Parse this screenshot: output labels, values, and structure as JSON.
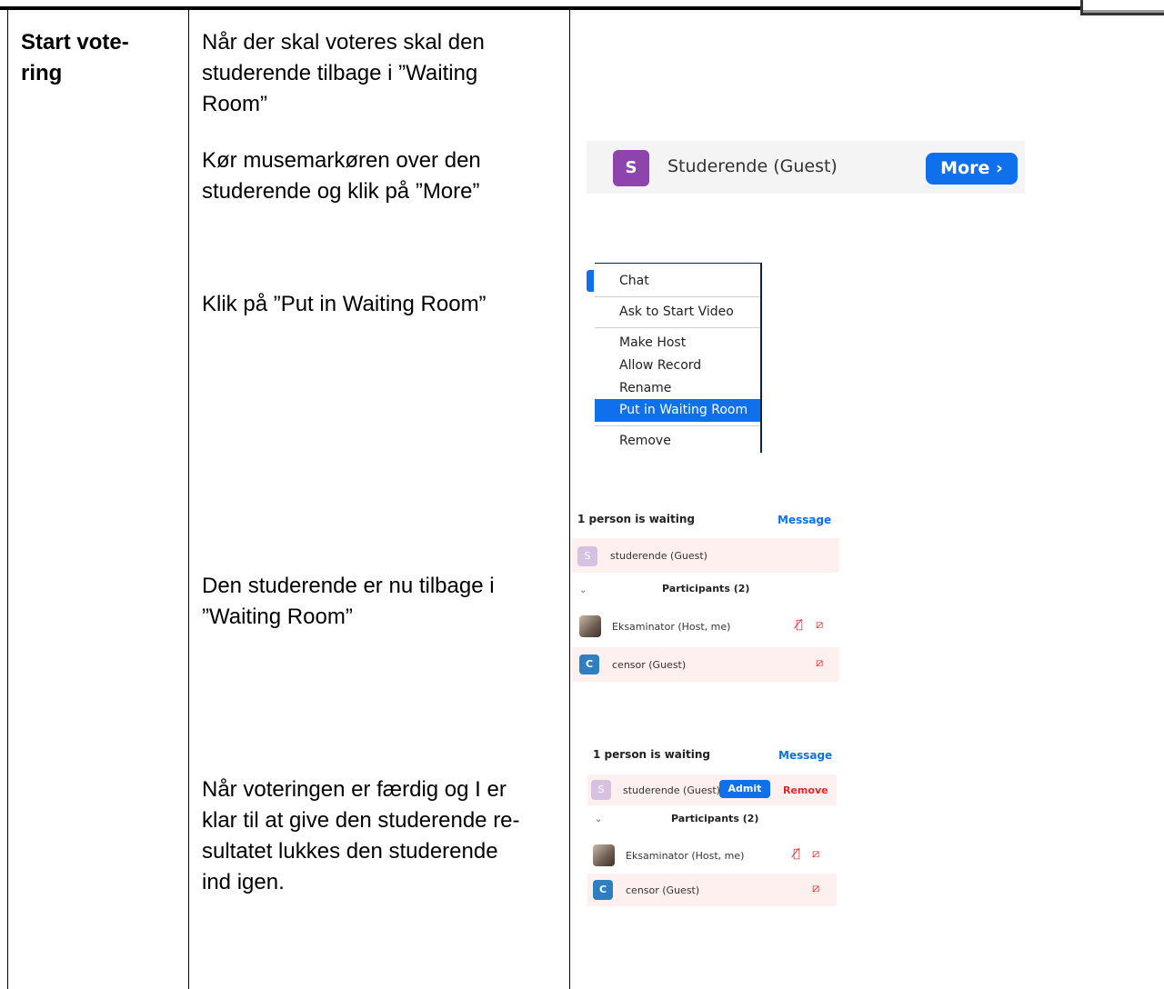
{
  "table": {
    "header_cell": "Start vote-\nring",
    "instructions": [
      "Når der skal voteres skal den\nstuderende tilbage i ”Waiting\nRoom”",
      "Kør musemarkøren over den\nstuderende og klik på ”More”",
      "Klik på ”Put in Waiting Room”",
      "Den studerende er nu tilbage i\n”Waiting Room”",
      "Når voteringen er færdig og I er\nklar til at give den studerende re-\nsultatet lukkes den studerende\nind igen."
    ]
  },
  "more_bar": {
    "avatar_letter": "S",
    "name": "Studerende (Guest)",
    "more_button": "More ›"
  },
  "context_menu": {
    "items": [
      "Chat",
      "Ask to Start Video",
      "Make Host",
      "Allow Record",
      "Rename",
      "Put in Waiting Room",
      "Remove"
    ],
    "selected": "Put in Waiting Room"
  },
  "waiting_panel_1": {
    "title": "1 person is waiting",
    "message_link": "Message",
    "waiting_user": {
      "avatar": "S",
      "name": "studerende (Guest)"
    },
    "participants_header": "Participants (2)",
    "participants": [
      {
        "avatar": "",
        "name": "Eksaminator (Host, me)",
        "icons": [
          "mic-muted-icon",
          "video-off-icon"
        ]
      },
      {
        "avatar": "C",
        "name": "censor (Guest)",
        "icons": [
          "video-off-icon"
        ]
      }
    ]
  },
  "waiting_panel_2": {
    "title": "1 person is waiting",
    "message_link": "Message",
    "waiting_user": {
      "avatar": "S",
      "name": "studerende (Guest)"
    },
    "admit_button": "Admit",
    "remove_button": "Remove",
    "participants_header": "Participants (2)",
    "participants": [
      {
        "avatar": "",
        "name": "Eksaminator (Host, me)",
        "icons": [
          "mic-muted-icon",
          "video-off-icon"
        ]
      },
      {
        "avatar": "C",
        "name": "censor (Guest)",
        "icons": [
          "video-off-icon"
        ]
      }
    ]
  },
  "colors": {
    "zoom_blue": "#0e71eb",
    "avatar_purple": "#8e44ad",
    "remove_red": "#e02828"
  }
}
